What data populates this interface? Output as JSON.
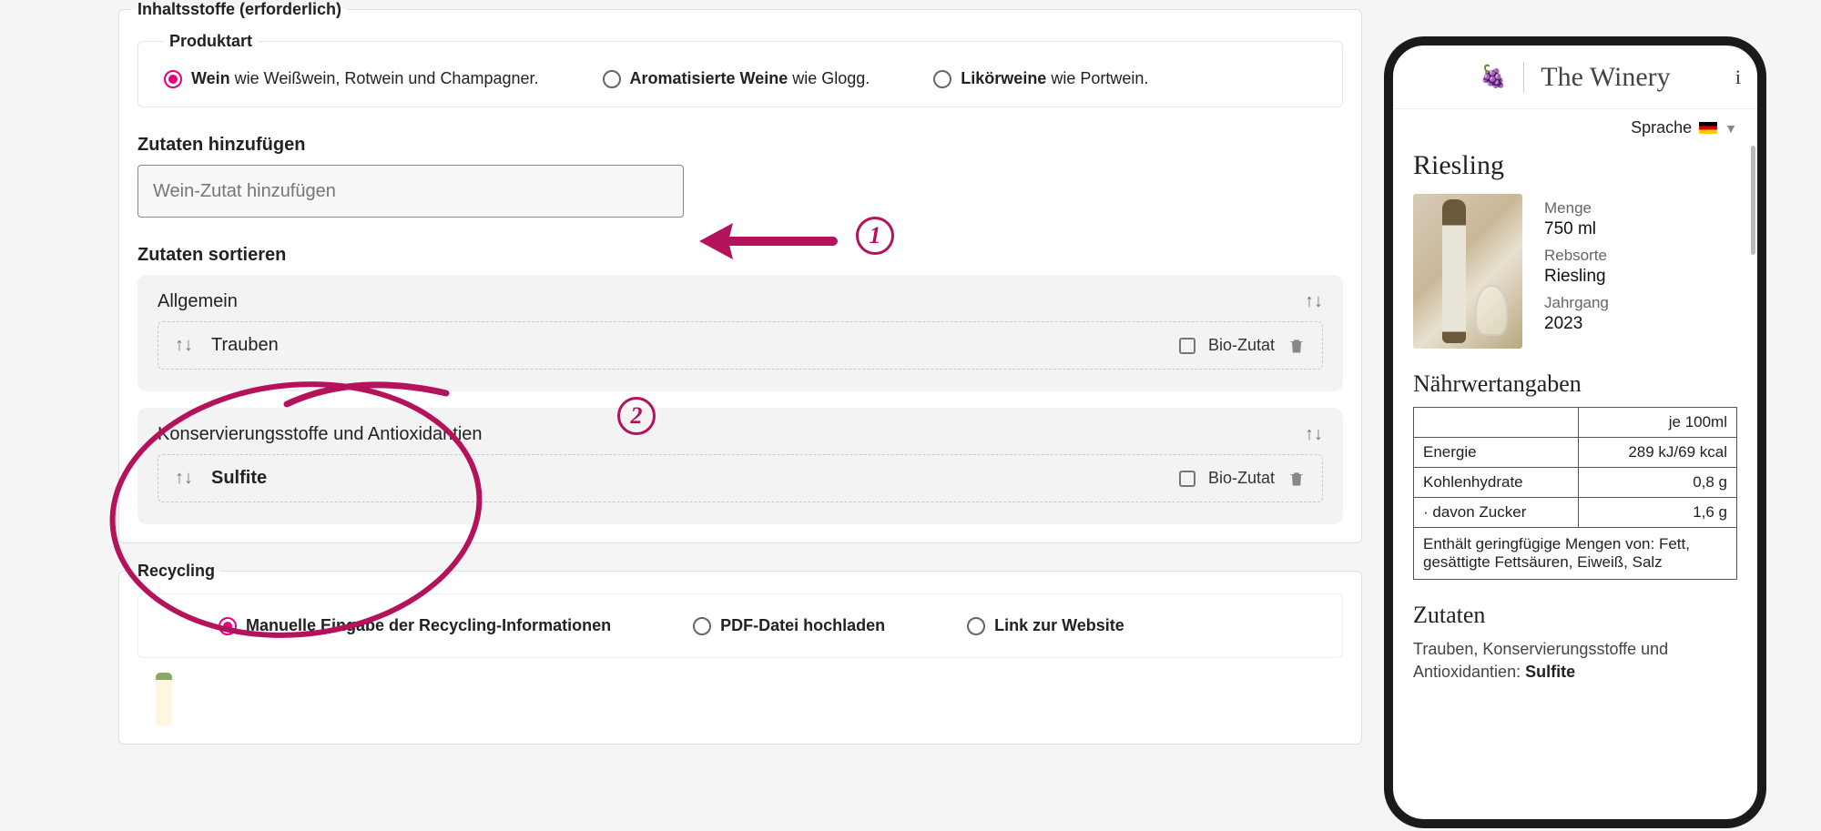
{
  "ingredients_section": {
    "legend": "Inhaltsstoffe (erforderlich)",
    "product_type_legend": "Produktart",
    "radios": {
      "wine_bold": "Wein",
      "wine_rest": " wie Weißwein, Rotwein und Champagner.",
      "aroma_bold": "Aromatisierte Weine",
      "aroma_rest": " wie Glogg.",
      "likor_bold": "Likörweine",
      "likor_rest": " wie Portwein."
    },
    "add_heading": "Zutaten hinzufügen",
    "add_placeholder": "Wein-Zutat hinzufügen",
    "sort_heading": "Zutaten sortieren",
    "group_general": "Allgemein",
    "group_preserv": "Konservierungsstoffe und Antioxidantien",
    "item_trauben": "Trauben",
    "item_sulfite": "Sulfite",
    "bio_label": "Bio-Zutat"
  },
  "annotations": {
    "one": "1",
    "two": "2"
  },
  "recycling": {
    "legend": "Recycling",
    "manual_label": "Manuelle Eingabe der Recycling-Informationen",
    "pdf_label": "PDF-Datei hochladen",
    "link_label": "Link zur Website"
  },
  "phone": {
    "brand": "The Winery",
    "language_label": "Sprache",
    "title": "Riesling",
    "meta": {
      "menge_label": "Menge",
      "menge_val": "750 ml",
      "rebsorte_label": "Rebsorte",
      "rebsorte_val": "Riesling",
      "jahrgang_label": "Jahrgang",
      "jahrgang_val": "2023"
    },
    "nutri_heading": "Nährwertangaben",
    "per_100": "je 100ml",
    "rows": {
      "energie_l": "Energie",
      "energie_v": "289 kJ/69 kcal",
      "kh_l": "Kohlenhydrate",
      "kh_v": "0,8 g",
      "zucker_l": "· davon Zucker",
      "zucker_v": "1,6 g"
    },
    "nutri_note": "Enthält geringfügige Mengen von: Fett, gesättigte Fettsäuren, Eiweiß, Salz",
    "zutaten_heading": "Zutaten",
    "zutaten_text_pre": "Trauben, Konservierungsstoffe und Antioxidantien: ",
    "zutaten_text_bold": "Sulfite"
  }
}
